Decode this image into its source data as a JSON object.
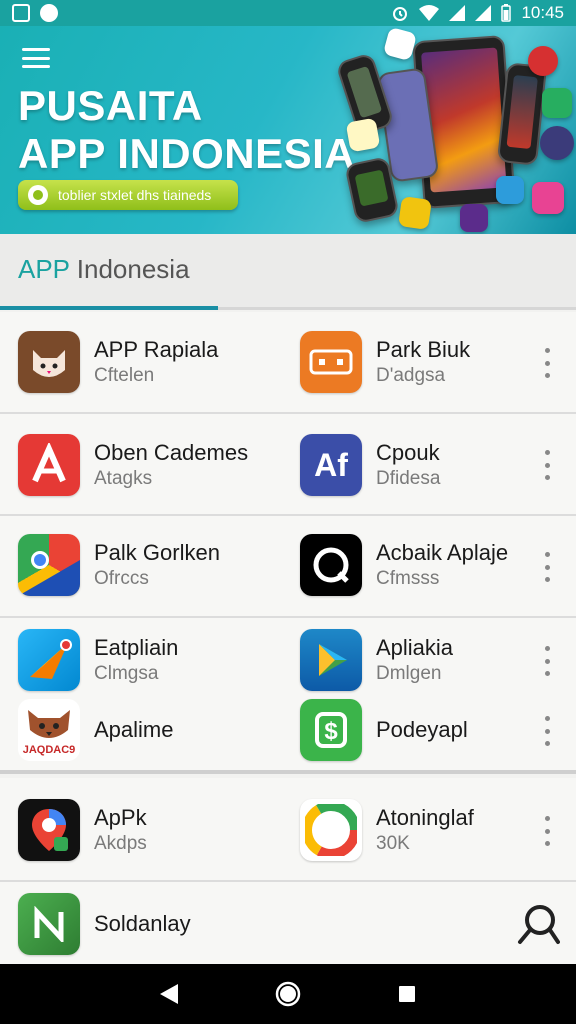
{
  "statusbar": {
    "time": "10:45"
  },
  "banner": {
    "title_line1": "PUSAITA",
    "title_line2": "APP INDONESIA",
    "pill_text": "toblier stxlet dhs tiaineds"
  },
  "tab": {
    "label_accent": "APP",
    "label_rest": " Indonesia"
  },
  "rows": [
    {
      "left": {
        "name": "APP Rapiala",
        "sub": "Cftelen",
        "icon": "cat-icon"
      },
      "right": {
        "name": "Park Biuk",
        "sub": "D'adgsa",
        "icon": "orange-card-icon"
      }
    },
    {
      "left": {
        "name": "Oben Cademes",
        "sub": "Atagks",
        "icon": "letter-a-icon"
      },
      "right": {
        "name": "Cpouk",
        "sub": "Dfidesa",
        "icon": "af-icon"
      }
    },
    {
      "left": {
        "name": "Palk Gorlken",
        "sub": "Ofrccs",
        "icon": "chrome-like-icon"
      },
      "right": {
        "name": "Acbaik Aplaje",
        "sub": "Cfmsss",
        "icon": "ring-icon"
      }
    },
    {
      "left": {
        "name": "Eatpliain",
        "sub": "Clmgsa",
        "icon": "paper-plane-icon"
      },
      "right": {
        "name": "Apliakia",
        "sub": "Dmlgen",
        "icon": "play-icon"
      },
      "left2": {
        "name": "Apalime",
        "icon": "dog-icon",
        "caption": "JAQDAC9"
      },
      "right2": {
        "name": "Podeyapl",
        "icon": "dollar-icon"
      }
    },
    {
      "left": {
        "name": "ApPk",
        "sub": "Akdps",
        "icon": "maps-pin-icon"
      },
      "right": {
        "name": "Atoninglaf",
        "sub": "30K",
        "icon": "chrome-circle-icon"
      }
    },
    {
      "left": {
        "name": "Soldanlay",
        "icon": "green-n-icon"
      }
    }
  ],
  "colors": {
    "accent": "#1aa2a0",
    "tab_indicator": "#1a8fa5"
  }
}
